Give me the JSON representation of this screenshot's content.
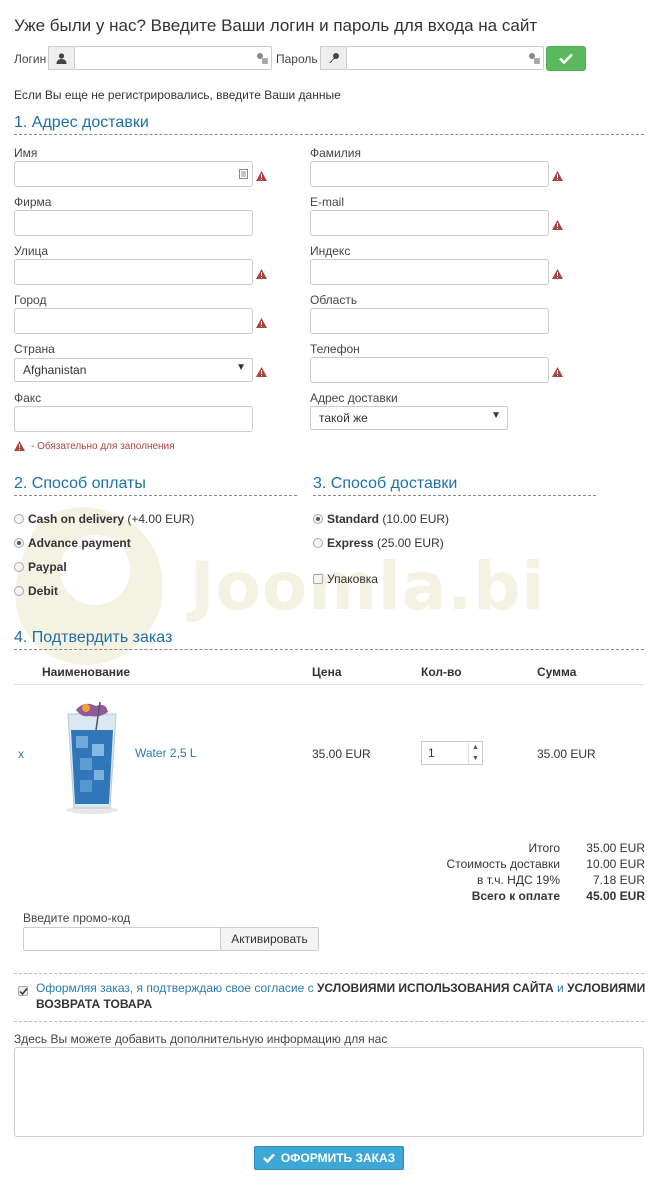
{
  "watermark": "Joomla.bi",
  "login": {
    "title": "Уже были у нас? Введите Ваши логин и пароль для входа на сайт",
    "login_label": "Логин",
    "password_label": "Пароль"
  },
  "register_note": "Если Вы еще не регистрировались, введите Ваши данные",
  "address": {
    "title": "1. Адрес доставки",
    "first_name": "Имя",
    "last_name": "Фамилия",
    "company": "Фирма",
    "email": "E-mail",
    "street": "Улица",
    "zip": "Индекс",
    "city": "Город",
    "region": "Область",
    "country": "Страна",
    "country_value": "Afghanistan",
    "phone": "Телефон",
    "fax": "Факс",
    "delivery_address": "Адрес доставки",
    "delivery_address_value": "такой же",
    "required_note": "- Обязательно для заполнения"
  },
  "payment": {
    "title": "2. Способ оплаты",
    "options": [
      {
        "label": "Cash on delivery",
        "extra": " (+4.00 EUR)",
        "selected": false
      },
      {
        "label": "Advance payment",
        "extra": "",
        "selected": true
      },
      {
        "label": "Paypal",
        "extra": "",
        "selected": false
      },
      {
        "label": "Debit",
        "extra": "",
        "selected": false
      }
    ]
  },
  "shipping": {
    "title": "3. Способ доставки",
    "options": [
      {
        "label": "Standard",
        "extra": " (10.00 EUR)",
        "selected": true
      },
      {
        "label": "Express",
        "extra": " (25.00 EUR)",
        "selected": false
      }
    ],
    "packaging_label": "Упаковка"
  },
  "confirm": {
    "title": "4. Подтвердить заказ",
    "columns": [
      "Наименование",
      "Цена",
      "Кол-во",
      "Сумма"
    ],
    "item": {
      "remove": "x",
      "name": "Water 2,5 L",
      "price": "35.00 EUR",
      "quantity": "1",
      "sum": "35.00 EUR"
    },
    "totals": [
      {
        "label": "Итого",
        "value": "35.00 EUR",
        "bold": false
      },
      {
        "label": "Стоимость доставки",
        "value": "10.00 EUR",
        "bold": false
      },
      {
        "label": "в т.ч. НДС 19%",
        "value": "7.18 EUR",
        "bold": false
      },
      {
        "label": "Всего к оплате",
        "value": "45.00 EUR",
        "bold": true
      }
    ],
    "promo_label": "Введите промо-код",
    "promo_button": "Активировать",
    "agree_text": "Оформляя заказ, я подтверждаю свое согласие с ",
    "agree_terms": "УСЛОВИЯМИ ИСПОЛЬЗОВАНИЯ САЙТА",
    "agree_and": " и ",
    "agree_return": "УСЛОВИЯМИ",
    "agree_return2": "ВОЗВРАТА ТОВАРА",
    "comment_label": "Здесь Вы можете добавить дополнительную информацию для нас",
    "submit": "ОФОРМИТЬ ЗАКАЗ"
  },
  "colors": {
    "accent": "#1f6fa8",
    "link": "#2b7ab0",
    "ok_button": "#5cb85c",
    "submit_button": "#3da7d6",
    "warning": "#a94442"
  }
}
